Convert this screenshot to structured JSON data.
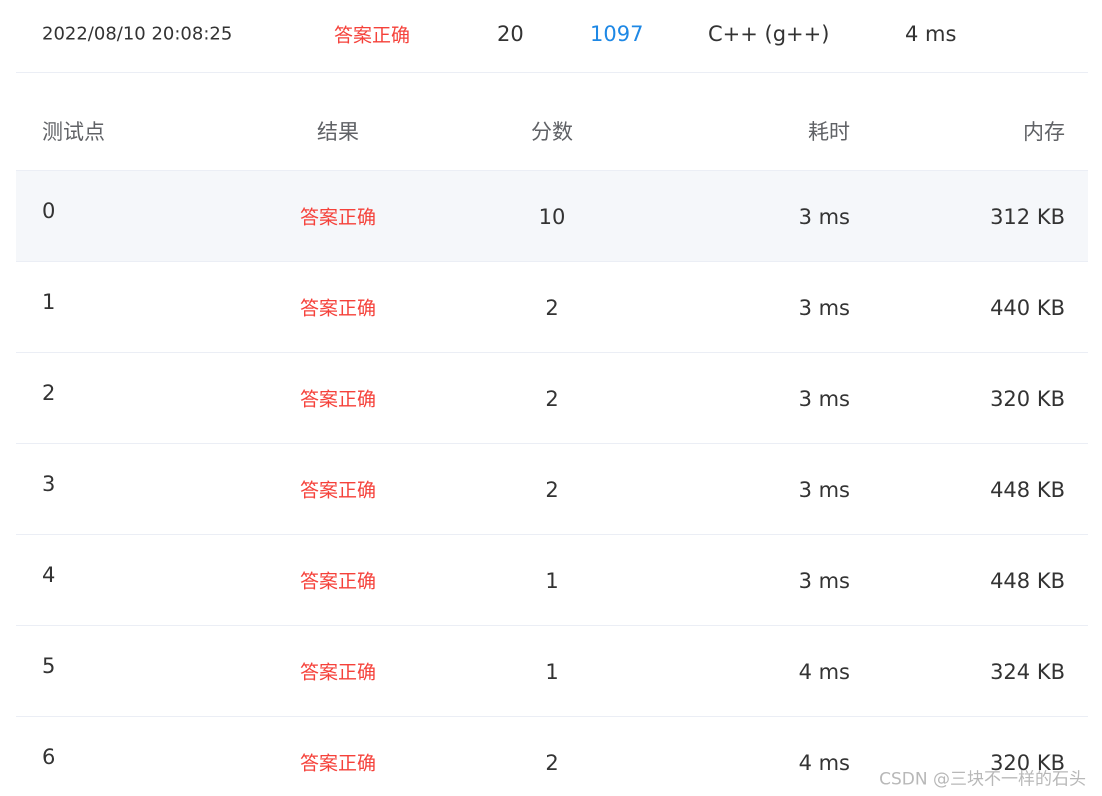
{
  "summary": {
    "submit_time": "2022/08/10 20:08:25",
    "status": "答案正确",
    "score": "20",
    "problem_id": "1097",
    "language": "C++ (g++)",
    "runtime": "4 ms"
  },
  "table": {
    "headers": {
      "case": "测试点",
      "result": "结果",
      "score": "分数",
      "time": "耗时",
      "memory": "内存"
    },
    "rows": [
      {
        "case": "0",
        "result": "答案正确",
        "score": "10",
        "time": "3 ms",
        "memory": "312 KB"
      },
      {
        "case": "1",
        "result": "答案正确",
        "score": "2",
        "time": "3 ms",
        "memory": "440 KB"
      },
      {
        "case": "2",
        "result": "答案正确",
        "score": "2",
        "time": "3 ms",
        "memory": "320 KB"
      },
      {
        "case": "3",
        "result": "答案正确",
        "score": "2",
        "time": "3 ms",
        "memory": "448 KB"
      },
      {
        "case": "4",
        "result": "答案正确",
        "score": "1",
        "time": "3 ms",
        "memory": "448 KB"
      },
      {
        "case": "5",
        "result": "答案正确",
        "score": "1",
        "time": "4 ms",
        "memory": "324 KB"
      },
      {
        "case": "6",
        "result": "答案正确",
        "score": "2",
        "time": "4 ms",
        "memory": "320 KB"
      }
    ]
  },
  "watermark": "CSDN @三块不一样的石头",
  "colors": {
    "status_correct": "#f5413a",
    "link": "#1e88e5",
    "row_highlight": "#f5f7fa",
    "divider": "#ebeef5"
  }
}
